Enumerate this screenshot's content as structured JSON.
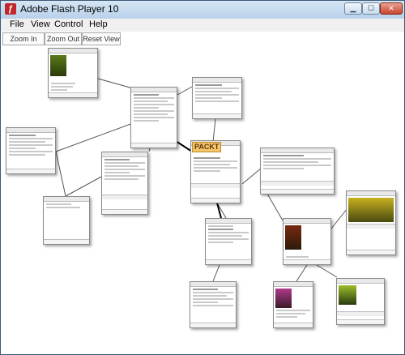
{
  "window": {
    "title": "Adobe Flash Player 10",
    "app_icon": "flash-player-icon"
  },
  "title_buttons": {
    "minimize": "▁",
    "maximize": "☐",
    "close": "✕"
  },
  "menu": [
    "File",
    "View",
    "Control",
    "Help"
  ],
  "toolbar": {
    "zoom_in": "Zoom In",
    "zoom_out": "Zoom Out",
    "reset_view": "Reset View"
  },
  "canvas": {
    "logo_text": "PACKT"
  },
  "colors": {
    "title_bar": "#b8d1ea",
    "close_button": "#c8442b",
    "node_border": "#8a8a8a",
    "link": "#555555"
  }
}
